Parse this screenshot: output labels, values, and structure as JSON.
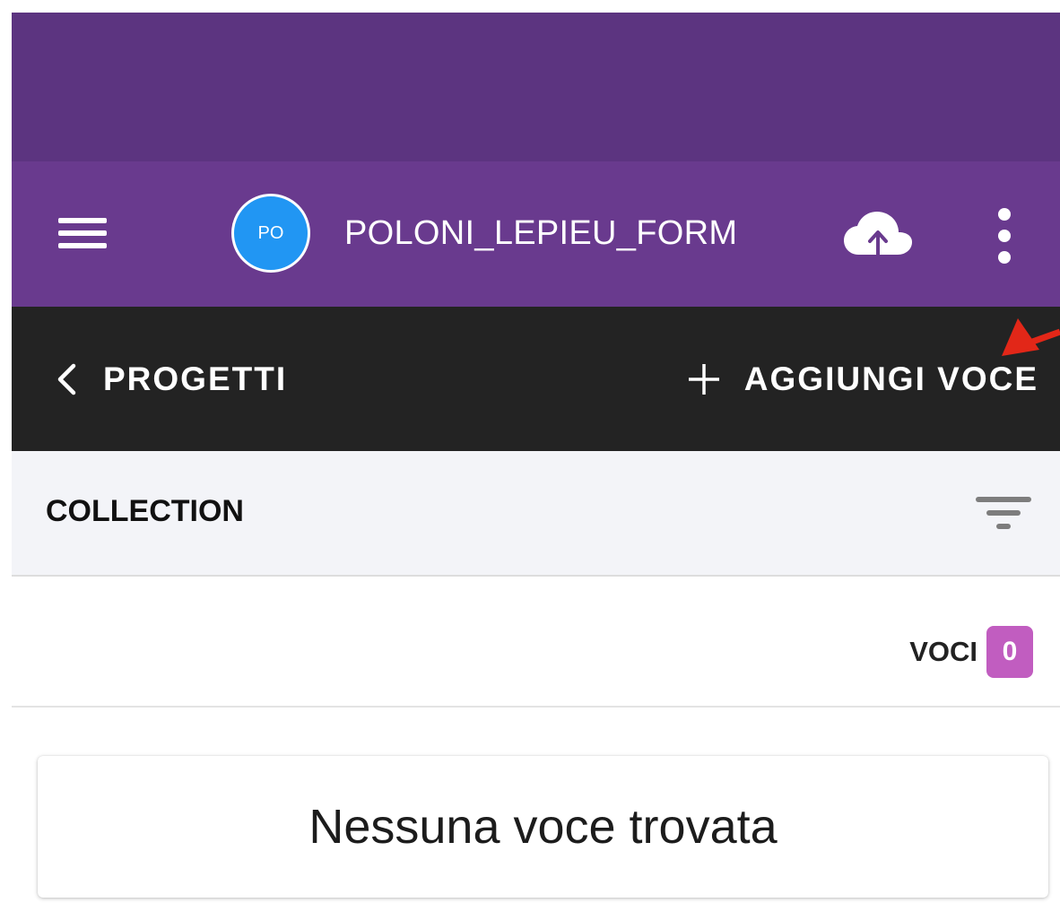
{
  "app_bar": {
    "avatar_initials": "PO",
    "project_name": "POLONI_LEPIEU_FORM",
    "menu_icon": "hamburger-menu-icon",
    "upload_icon": "cloud-upload-icon",
    "more_icon": "more-vert-icon",
    "colors": {
      "status_bar": "#5c3480",
      "app_bar": "#693a8e",
      "avatar": "#2196f3"
    }
  },
  "nav_bar": {
    "back_label": "PROGETTI",
    "add_label": "AGGIUNGI VOCE",
    "back_icon": "chevron-left-icon",
    "add_icon": "plus-icon",
    "background": "#232323",
    "annotation": "red-arrow-pointer"
  },
  "collection": {
    "title": "COLLECTION",
    "filter_icon": "filter-icon"
  },
  "items": {
    "label": "VOCI",
    "count": "0",
    "badge_color": "#c15dc0"
  },
  "empty_state": {
    "message": "Nessuna voce trovata"
  }
}
